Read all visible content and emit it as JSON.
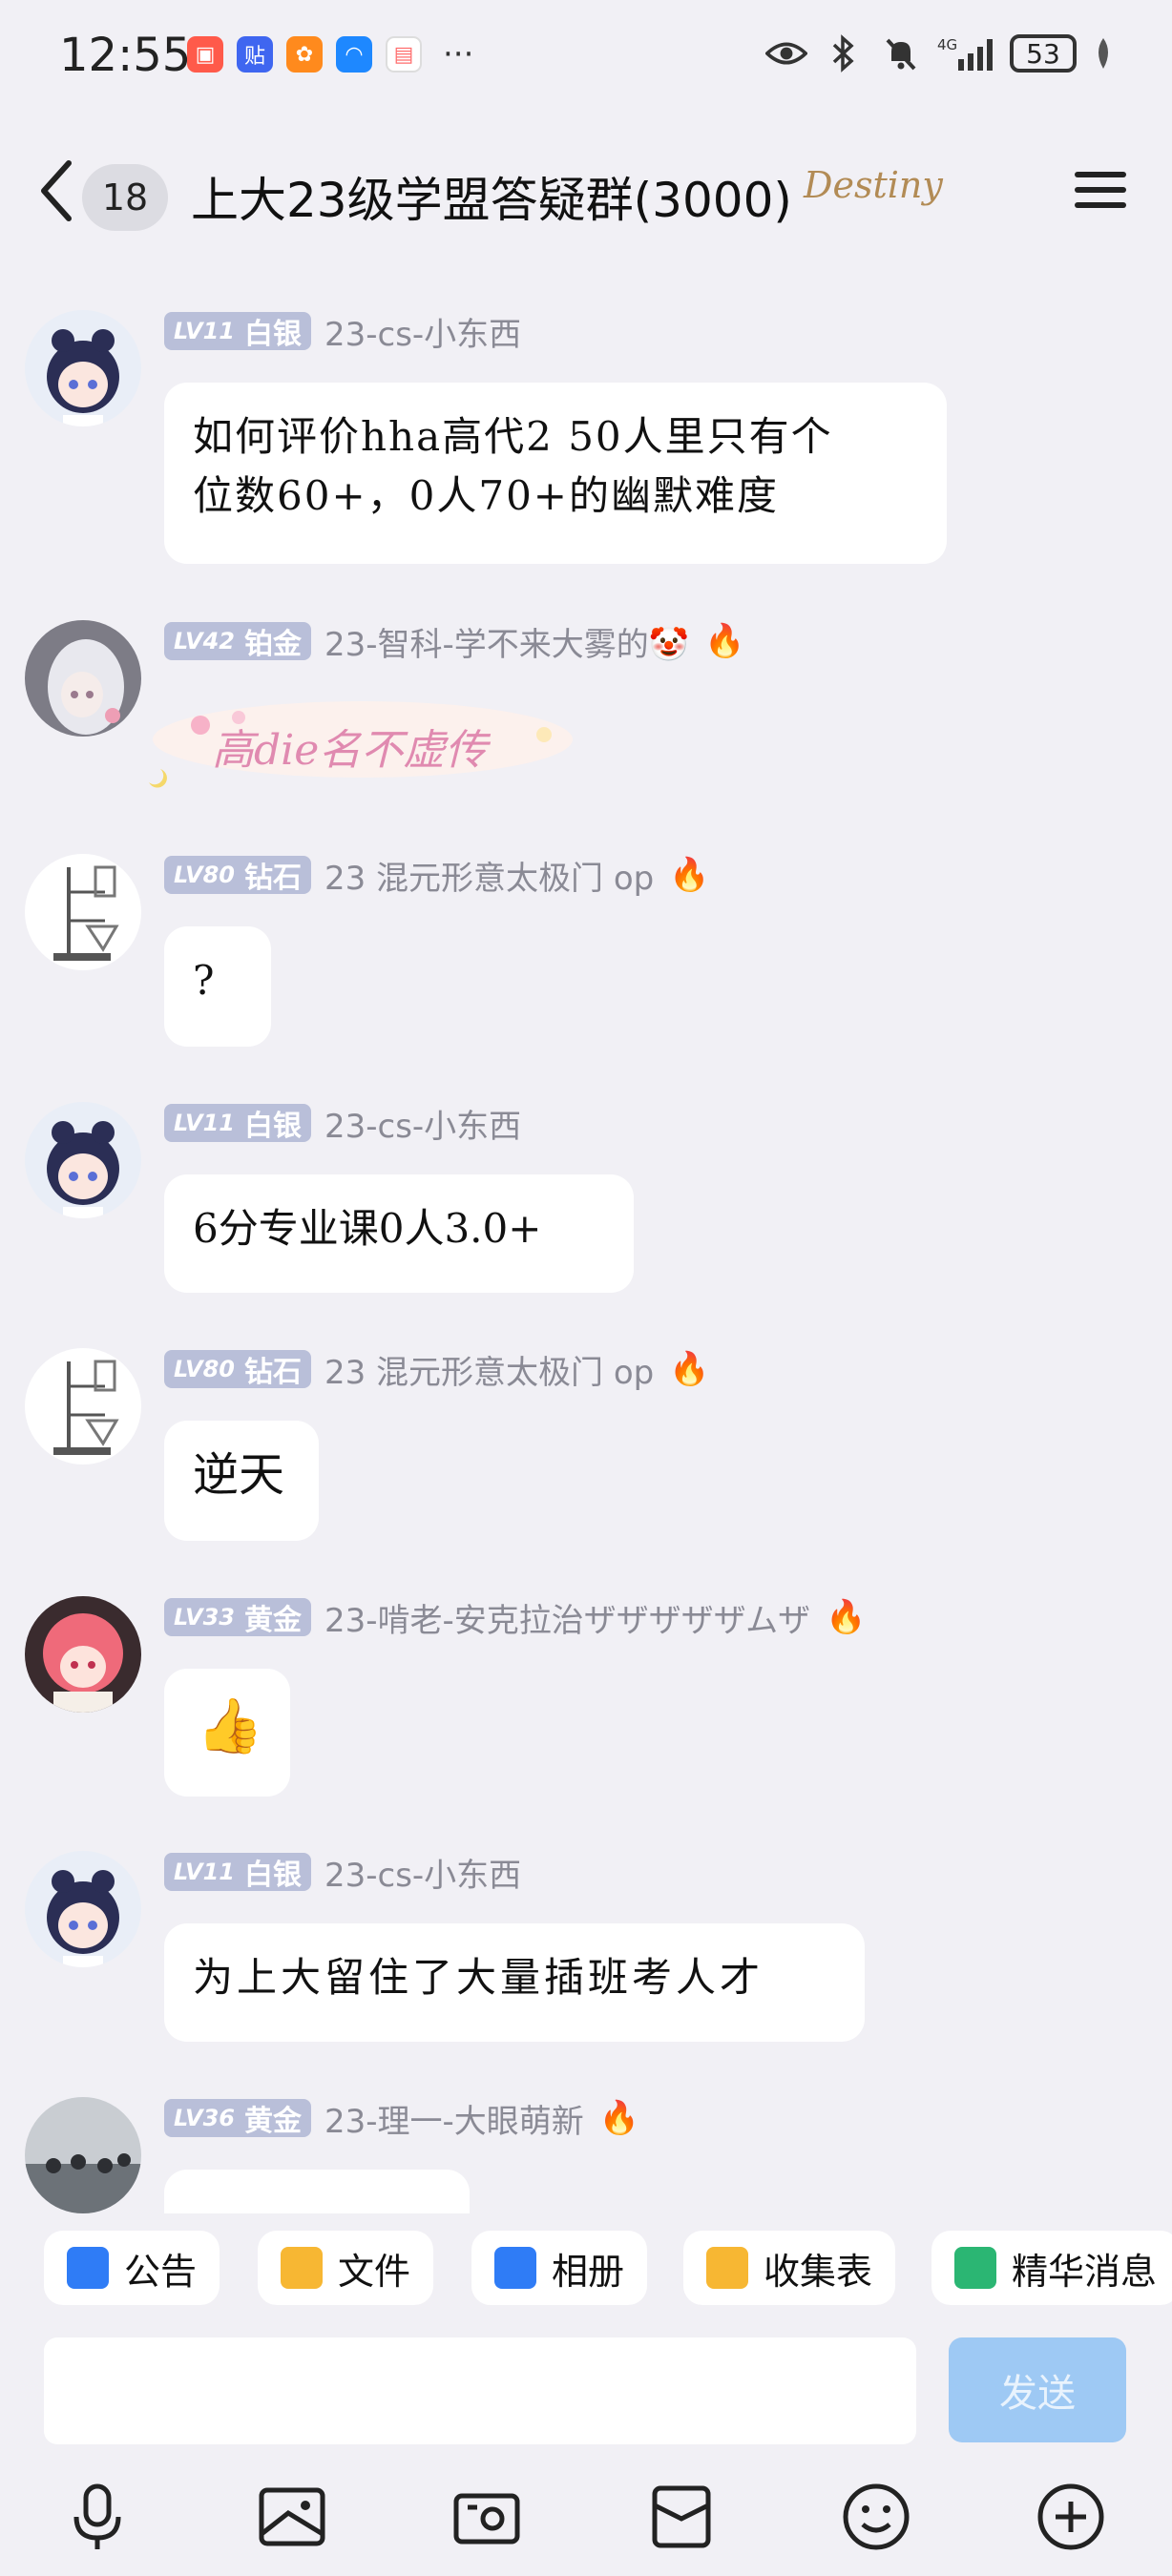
{
  "status_bar": {
    "time": "12:55",
    "app_icons": [
      {
        "name": "red-app-icon",
        "label": "",
        "color": "#ff5a4a"
      },
      {
        "name": "tieba-icon",
        "label": "贴",
        "color": "#3f66f0"
      },
      {
        "name": "orange-app-icon",
        "label": "",
        "color": "#ff8a1d"
      },
      {
        "name": "wifi-app-icon",
        "label": "",
        "color": "#1e88ff"
      },
      {
        "name": "calendar-app-icon",
        "label": "",
        "color": "#ff6d6d"
      }
    ],
    "more": "···",
    "signal_label": "4G",
    "battery": "53"
  },
  "header": {
    "unread_count": "18",
    "title": "上大23级学盟答疑群(3000)",
    "title_badge": "Destiny"
  },
  "messages": [
    {
      "avatar": "anime-girl-blue",
      "level_num": "LV11",
      "level_name": "白银",
      "nickname": "23-cs-小东西",
      "fire": false,
      "text": "如何评价hha高代2 50人里只有个\n位数60+，0人70+的幽默难度"
    },
    {
      "avatar": "anime-girl-white",
      "level_num": "LV42",
      "level_name": "铂金",
      "nickname": "23-智科-学不来大雾的🤡",
      "fire": true,
      "sticker": "高die名不虚传"
    },
    {
      "avatar": "lab-stand",
      "level_num": "LV80",
      "level_name": "钻石",
      "nickname": "23 混元形意太极门 op",
      "fire": true,
      "text": "?"
    },
    {
      "avatar": "anime-girl-blue",
      "level_num": "LV11",
      "level_name": "白银",
      "nickname": "23-cs-小东西",
      "fire": false,
      "text": "6分专业课0人3.0+"
    },
    {
      "avatar": "lab-stand",
      "level_num": "LV80",
      "level_name": "钻石",
      "nickname": "23 混元形意太极门 op",
      "fire": true,
      "text": "逆天"
    },
    {
      "avatar": "anime-girl-pink",
      "level_num": "LV33",
      "level_name": "黄金",
      "nickname": "23-啃老-安克拉治ザザザザザムザ",
      "fire": true,
      "text": "👍"
    },
    {
      "avatar": "anime-girl-blue",
      "level_num": "LV11",
      "level_name": "白银",
      "nickname": "23-cs-小东西",
      "fire": false,
      "text": "为上大留住了大量插班考人才"
    },
    {
      "avatar": "crowd-photo",
      "level_num": "LV36",
      "level_name": "黄金",
      "nickname": "23-理一-大眼萌新",
      "fire": true,
      "text": ""
    }
  ],
  "tabs": [
    {
      "label": "公告",
      "icon": "announcement-icon",
      "color": "#2f7cf6"
    },
    {
      "label": "文件",
      "icon": "folder-icon",
      "color": "#f7b733"
    },
    {
      "label": "相册",
      "icon": "album-icon",
      "color": "#2f7cf6"
    },
    {
      "label": "收集表",
      "icon": "form-icon",
      "color": "#f7b733"
    },
    {
      "label": "精华消息",
      "icon": "essence-icon",
      "color": "#2bb673"
    }
  ],
  "input": {
    "placeholder": "",
    "send_label": "发送"
  },
  "toolbar_icons": [
    "microphone-icon",
    "image-icon",
    "camera-icon",
    "red-packet-icon",
    "emoji-icon",
    "plus-icon"
  ]
}
